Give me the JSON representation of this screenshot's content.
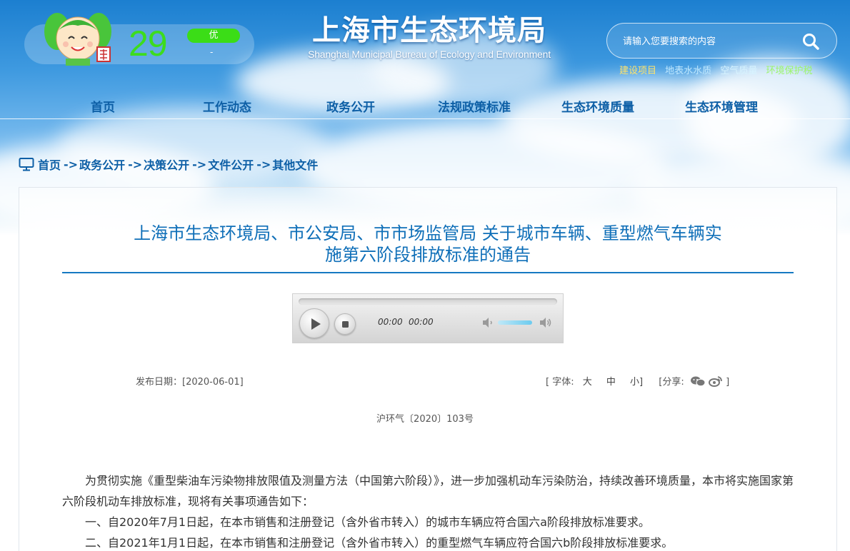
{
  "header": {
    "aqi_value": "29",
    "aqi_level": "优",
    "aqi_sub": "-",
    "site_title": "上海市生态环境局",
    "site_subtitle": "Shanghai Municipal Bureau of Ecology and Environment",
    "search_placeholder": "请输入您要搜索的内容",
    "quick_links": [
      {
        "label": "建设项目",
        "color": "#ffe36b"
      },
      {
        "label": "地表水水质",
        "color": "#bfe8ff"
      },
      {
        "label": "空气质量",
        "color": "#d8f4ff"
      },
      {
        "label": "环境保护税",
        "color": "#9cf56a"
      }
    ]
  },
  "nav": {
    "items": [
      "首页",
      "工作动态",
      "政务公开",
      "法规政策标准",
      "生态环境质量",
      "生态环境管理"
    ]
  },
  "breadcrumb": {
    "separator": "->",
    "items": [
      "首页",
      "政务公开",
      "决策公开",
      "文件公开",
      "其他文件"
    ]
  },
  "article": {
    "title_line1": "上海市生态环境局、市公安局、市市场监管局 关于城市车辆、重型燃气车辆实",
    "title_line2": "施第六阶段排放标准的通告",
    "publish_date": "发布日期：[2020-06-01]",
    "font_label": "[ 字体:",
    "font_large": "大",
    "font_medium": "中",
    "font_small": "小]",
    "share_label": "[分享:",
    "share_close": "]",
    "doc_number": "沪环气〔2020〕103号",
    "paragraphs": [
      "为贯彻实施《重型柴油车污染物排放限值及测量方法（中国第六阶段）》，进一步加强机动车污染防治，持续改善环境质量，本市将实施国家第六阶段机动车排放标准，现将有关事项通告如下：",
      "一、自2020年7月1日起，在本市销售和注册登记（含外省市转入）的城市车辆应符合国六a阶段排放标准要求。",
      "二、自2021年1月1日起，在本市销售和注册登记（含外省市转入）的重型燃气车辆应符合国六b阶段排放标准要求。"
    ]
  },
  "player": {
    "current_time": "00:00",
    "total_time": "00:00",
    "volume": 0.7
  },
  "colors": {
    "nav_text": "#0d5fa6",
    "title_blue": "#0f6fb8",
    "aqi_green": "#3ddc1e"
  }
}
